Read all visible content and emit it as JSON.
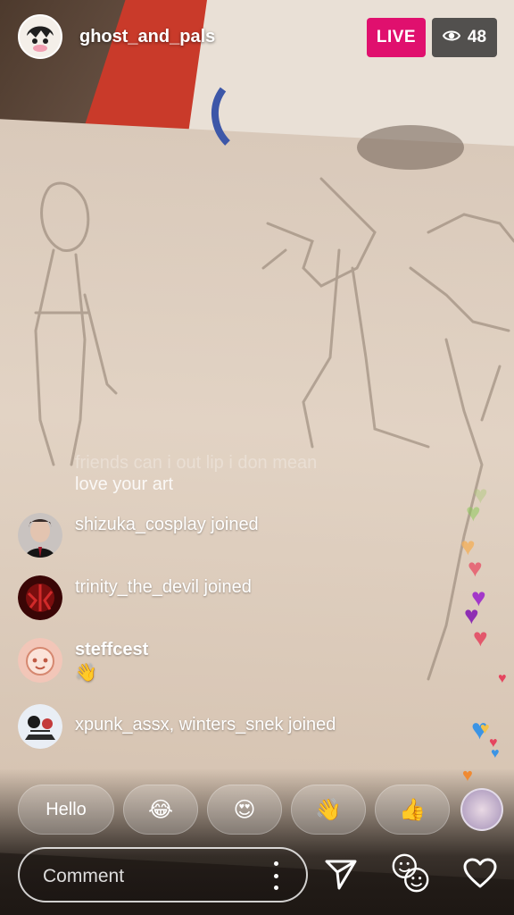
{
  "header": {
    "host_name": "ghost_and_pals",
    "live_label": "LIVE",
    "viewer_count": "48"
  },
  "comments": {
    "faded_text": "friends can i out lip i don mean",
    "love_text": "love your art",
    "items": [
      {
        "type": "joined",
        "text": "shizuka_cosplay joined"
      },
      {
        "type": "joined",
        "text": "trinity_the_devil joined"
      },
      {
        "type": "message",
        "user": "steffcest",
        "message": "👋"
      },
      {
        "type": "joined",
        "text": "xpunk_assx, winters_snek joined"
      }
    ]
  },
  "quick_reactions": [
    "Hello",
    "😂",
    "😍",
    "👋",
    "👍"
  ],
  "composer": {
    "placeholder": "Comment"
  },
  "colors": {
    "live_badge": "#e0106e",
    "viewer_badge": "#282828"
  },
  "icons": [
    "eye-icon",
    "more-vertical-icon",
    "send-icon",
    "face-filter-icon",
    "heart-icon"
  ]
}
